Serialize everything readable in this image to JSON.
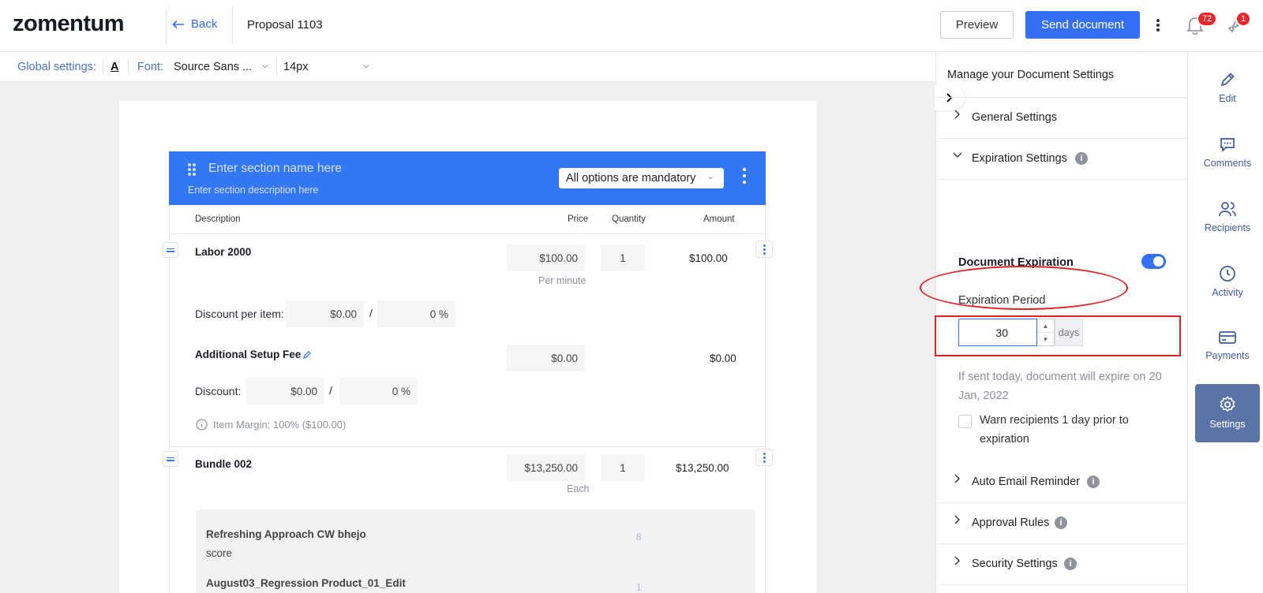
{
  "header": {
    "logo": "zomentum",
    "back_label": "Back",
    "proposal_title": "Proposal 1103",
    "preview_label": "Preview",
    "send_label": "Send document",
    "notifications_count": "72",
    "launch_count": "1"
  },
  "global_settings": {
    "label": "Global settings:",
    "text_color_glyph": "A",
    "font_label": "Font:",
    "font_value": "Source Sans ...",
    "size_value": "14px"
  },
  "section": {
    "name_placeholder": "Enter section name here",
    "desc_placeholder": "Enter section description here",
    "option_select": "All options are mandatory"
  },
  "table": {
    "headers": {
      "description": "Description",
      "price": "Price",
      "quantity": "Quantity",
      "amount": "Amount"
    },
    "item1": {
      "name": "Labor 2000",
      "price": "$100.00",
      "unit": "Per minute",
      "qty": "1",
      "amount": "$100.00",
      "discount_label": "Discount per item:",
      "discount_amount": "$0.00",
      "slash": "/",
      "discount_percent": "0 %"
    },
    "fee": {
      "name": "Additional Setup Fee",
      "price": "$0.00",
      "amount": "$0.00",
      "discount_label": "Discount:",
      "discount_amount": "$0.00",
      "slash": "/",
      "discount_percent": "0 %",
      "margin": "Item Margin: 100% ($100.00)"
    },
    "bundle": {
      "name": "Bundle 002",
      "price": "$13,250.00",
      "unit": "Each",
      "qty": "1",
      "amount": "$13,250.00",
      "sub1_name": "Refreshing Approach CW bhejo",
      "sub1_desc": "score",
      "sub1_qty": "8",
      "sub2_name": "August03_Regression Product_01_Edit",
      "sub2_qty": "1"
    }
  },
  "panel": {
    "title": "Manage your Document Settings",
    "general": "General Settings",
    "expiration": "Expiration Settings",
    "doc_expiration": "Document Expiration",
    "expiration_period": "Expiration Period",
    "period_value": "30",
    "period_unit": "days",
    "expire_note": "If sent today, document will expire on 20 Jan, 2022",
    "warn_label": "Warn recipients 1 day prior to expiration",
    "auto_email": "Auto Email Reminder",
    "approval": "Approval Rules",
    "security": "Security Settings"
  },
  "rail": {
    "edit": "Edit",
    "comments": "Comments",
    "recipients": "Recipients",
    "activity": "Activity",
    "payments": "Payments",
    "settings": "Settings"
  },
  "colors": {
    "accent": "#3370f5",
    "section_bg": "#3477f5",
    "active_rail": "#5a74a8",
    "highlight": "#e02222",
    "badge": "#e8262d"
  }
}
